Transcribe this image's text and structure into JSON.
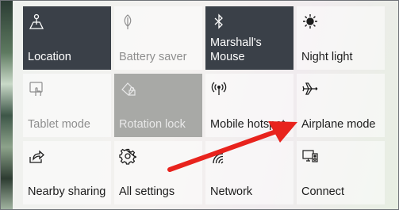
{
  "tiles": [
    {
      "label": "Location",
      "icon": "location-icon"
    },
    {
      "label": "Battery saver",
      "icon": "battery-saver-icon"
    },
    {
      "label": "Marshall's Mouse",
      "icon": "bluetooth-icon"
    },
    {
      "label": "Night light",
      "icon": "night-light-icon"
    },
    {
      "label": "Tablet mode",
      "icon": "tablet-mode-icon"
    },
    {
      "label": "Rotation lock",
      "icon": "rotation-lock-icon"
    },
    {
      "label": "Mobile hotspot",
      "icon": "mobile-hotspot-icon"
    },
    {
      "label": "Airplane mode",
      "icon": "airplane-icon"
    },
    {
      "label": "Nearby sharing",
      "icon": "nearby-sharing-icon"
    },
    {
      "label": "All settings",
      "icon": "settings-gear-icon"
    },
    {
      "label": "Network",
      "icon": "network-icon"
    },
    {
      "label": "Connect",
      "icon": "connect-icon"
    }
  ],
  "colors": {
    "tile_on": "#3a4048",
    "tile_off": "#ffffff",
    "annotation_arrow": "#e8231d"
  }
}
